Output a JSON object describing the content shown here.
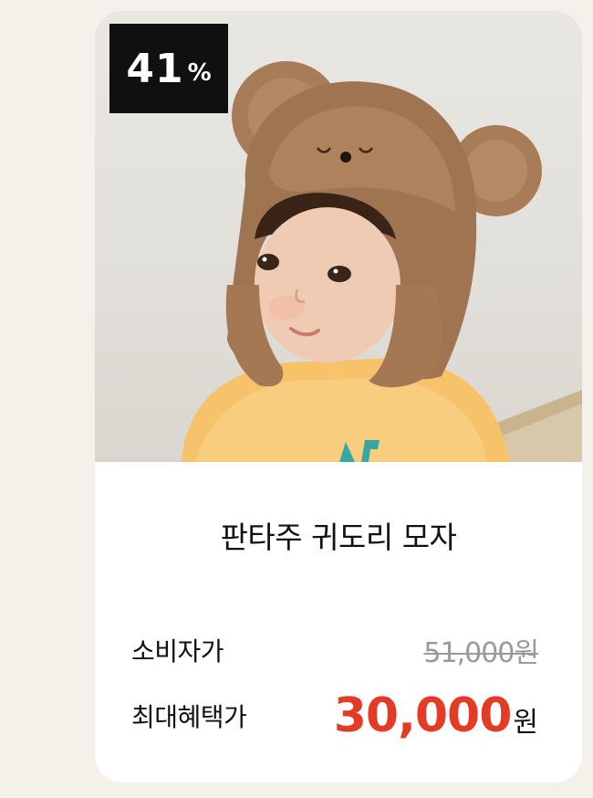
{
  "badge": {
    "discount_value": "41",
    "discount_unit": "%"
  },
  "product": {
    "title": "판타주 귀도리 모자"
  },
  "pricing": {
    "msrp_label": "소비자가",
    "msrp_value": "51,000원",
    "sale_label": "최대혜택가",
    "sale_value": "30,000",
    "sale_unit": "원"
  },
  "colors": {
    "background": "#f4f0ea",
    "card": "#ffffff",
    "badge": "#101010",
    "sale_price": "#e33b26",
    "msrp": "#9a9a9a"
  }
}
